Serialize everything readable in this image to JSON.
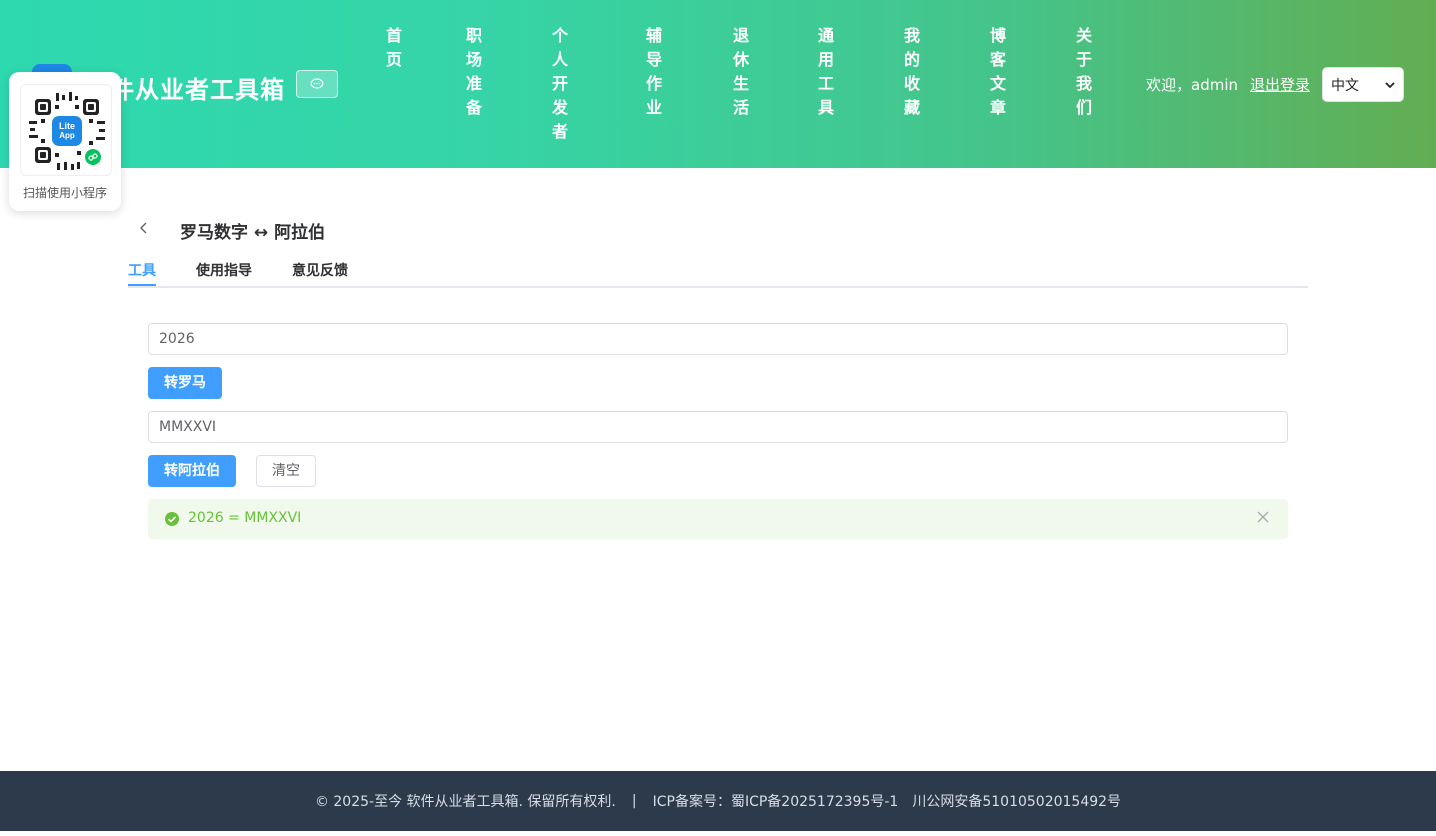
{
  "header": {
    "site_title": "件从业者工具箱",
    "nav": [
      {
        "label": "首页"
      },
      {
        "label": "职场准备"
      },
      {
        "label": "个人开发者"
      },
      {
        "label": "辅导作业"
      },
      {
        "label": "退休生活"
      },
      {
        "label": "通用工具"
      },
      {
        "label": "我的收藏"
      },
      {
        "label": "博客文章"
      },
      {
        "label": "关于我们"
      }
    ],
    "welcome": "欢迎，admin",
    "logout": "退出登录",
    "language": "中文"
  },
  "qr": {
    "logo_text_1": "Lite",
    "logo_text_2": "App",
    "caption": "扫描使用小程序"
  },
  "page": {
    "title": "罗马数字 ↔ 阿拉伯",
    "tabs": [
      {
        "label": "工具",
        "active": true
      },
      {
        "label": "使用指导",
        "active": false
      },
      {
        "label": "意见反馈",
        "active": false
      }
    ],
    "arabic_input": "2026",
    "to_roman_button": "转罗马",
    "roman_input": "MMXXVI",
    "to_arabic_button": "转阿拉伯",
    "clear_button": "清空",
    "result": "2026 = MMXXVI"
  },
  "footer": {
    "copyright": "© 2025-至今 软件从业者工具箱. 保留所有权利.",
    "separator": "|",
    "icp": "ICP备案号：蜀ICP备2025172395号-1",
    "police": "川公网安备51010502015492号"
  },
  "colors": {
    "accent": "#409eff",
    "success": "#67c23a",
    "footer_bg": "#2d3a4b"
  }
}
